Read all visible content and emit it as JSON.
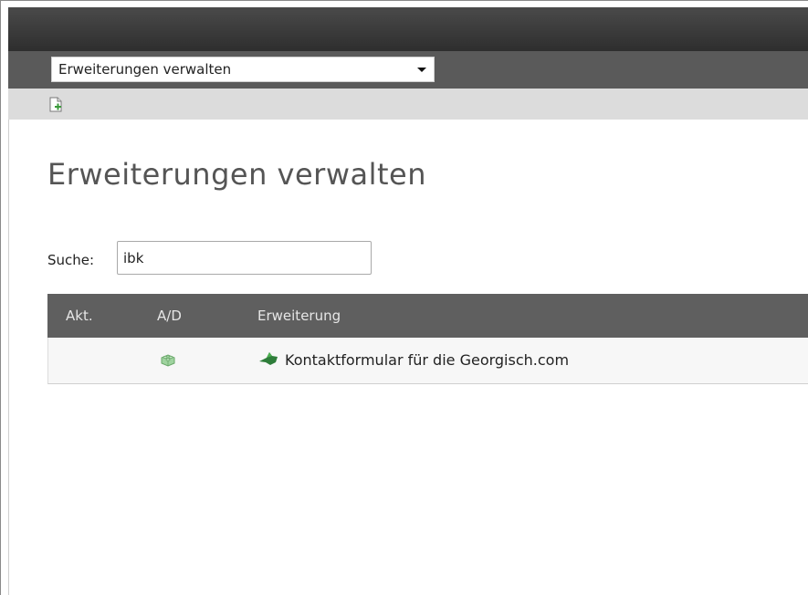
{
  "module_menu": {
    "selected": "Erweiterungen verwalten"
  },
  "page": {
    "title": "Erweiterungen verwalten"
  },
  "search": {
    "label": "Suche:",
    "value": "ibk"
  },
  "table": {
    "columns": [
      "Akt.",
      "A/D",
      "Erweiterung"
    ],
    "rows": [
      {
        "action": "",
        "ad_icon": "lego-brick-icon",
        "ext_icon": "extension-icon",
        "title": "Kontaktformular für die Georgisch.com"
      }
    ]
  },
  "colors": {
    "topbar": "#3a3a3a",
    "selectbar": "#5a5a5a",
    "table_header": "#5f5f5f",
    "accent_green": "#2e7d3a"
  }
}
